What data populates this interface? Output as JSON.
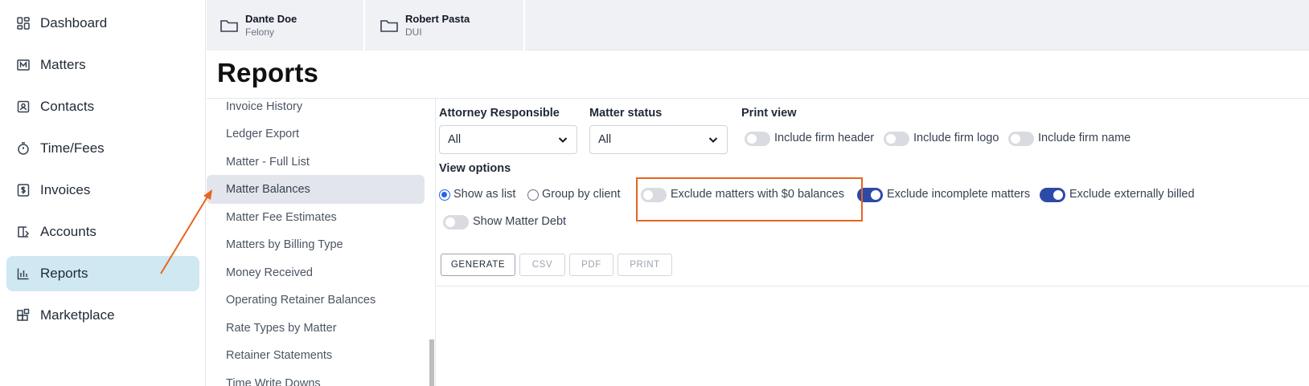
{
  "nav": {
    "items": [
      {
        "label": "Dashboard",
        "icon": "dashboard-icon"
      },
      {
        "label": "Matters",
        "icon": "matters-icon"
      },
      {
        "label": "Contacts",
        "icon": "contacts-icon"
      },
      {
        "label": "Time/Fees",
        "icon": "stopwatch-icon"
      },
      {
        "label": "Invoices",
        "icon": "invoice-dollar-icon"
      },
      {
        "label": "Accounts",
        "icon": "accounts-book-icon"
      },
      {
        "label": "Reports",
        "icon": "bar-chart-icon",
        "active": true
      },
      {
        "label": "Marketplace",
        "icon": "marketplace-icon"
      }
    ]
  },
  "tabs": [
    {
      "name": "Dante Doe",
      "sub": "Felony",
      "icon": "folder-icon"
    },
    {
      "name": "Robert Pasta",
      "sub": "DUI",
      "icon": "folder-icon"
    }
  ],
  "page": {
    "title": "Reports"
  },
  "report_list": {
    "items": [
      "Invoice History",
      "Ledger Export",
      "Matter - Full List",
      "Matter Balances",
      "Matter Fee Estimates",
      "Matters by Billing Type",
      "Money Received",
      "Operating Retainer Balances",
      "Rate Types by Matter",
      "Retainer Statements",
      "Time Write Downs"
    ],
    "selected": "Matter Balances"
  },
  "filters": {
    "attorney": {
      "label": "Attorney Responsible",
      "value": "All"
    },
    "status": {
      "label": "Matter status",
      "value": "All"
    },
    "print_view": {
      "label": "Print view",
      "toggles": [
        {
          "label": "Include firm header",
          "on": false
        },
        {
          "label": "Include firm logo",
          "on": false
        },
        {
          "label": "Include firm name",
          "on": false
        }
      ]
    },
    "view_options": {
      "label": "View options",
      "radios": [
        {
          "label": "Show as list",
          "selected": true
        },
        {
          "label": "Group by client",
          "selected": false
        }
      ],
      "toggles": [
        {
          "label": "Exclude matters with $0 balances",
          "on": false
        },
        {
          "label": "Exclude incomplete matters",
          "on": true
        },
        {
          "label": "Exclude externally billed",
          "on": true
        },
        {
          "label": "Show Matter Debt",
          "on": false
        }
      ]
    }
  },
  "actions": {
    "generate": "GENERATE",
    "csv": "CSV",
    "pdf": "PDF",
    "print": "PRINT"
  },
  "colors": {
    "active_nav_bg": "#cfe8f2",
    "toggle_on": "#2c4aa6",
    "annotation": "#e8651e"
  }
}
